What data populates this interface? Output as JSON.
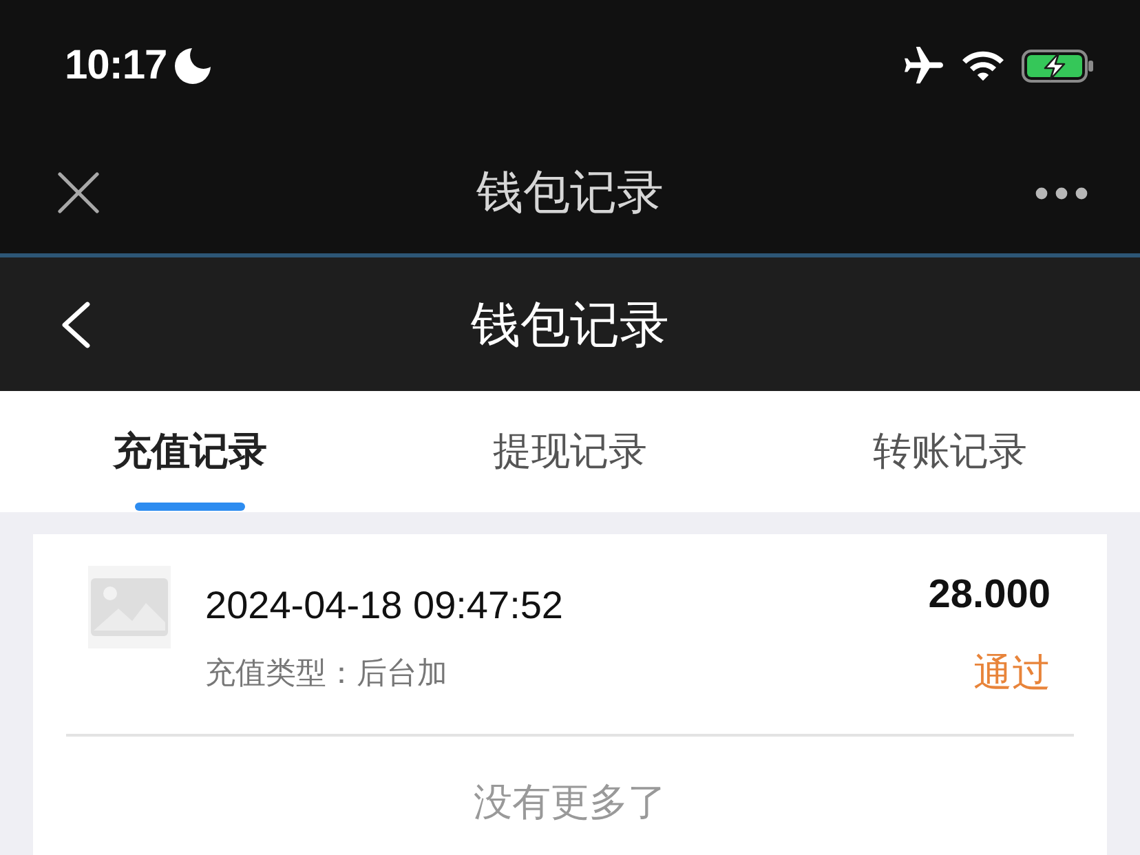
{
  "status_bar": {
    "time": "10:17"
  },
  "browser_bar": {
    "title": "钱包记录"
  },
  "header": {
    "title": "钱包记录"
  },
  "tabs": [
    {
      "label": "充值记录",
      "selected": true
    },
    {
      "label": "提现记录",
      "selected": false
    },
    {
      "label": "转账记录",
      "selected": false
    }
  ],
  "records": [
    {
      "datetime": "2024-04-18 09:47:52",
      "type": "充值类型：后台加",
      "amount": "28.000",
      "status": "通过"
    }
  ],
  "footer_note": "没有更多了"
}
